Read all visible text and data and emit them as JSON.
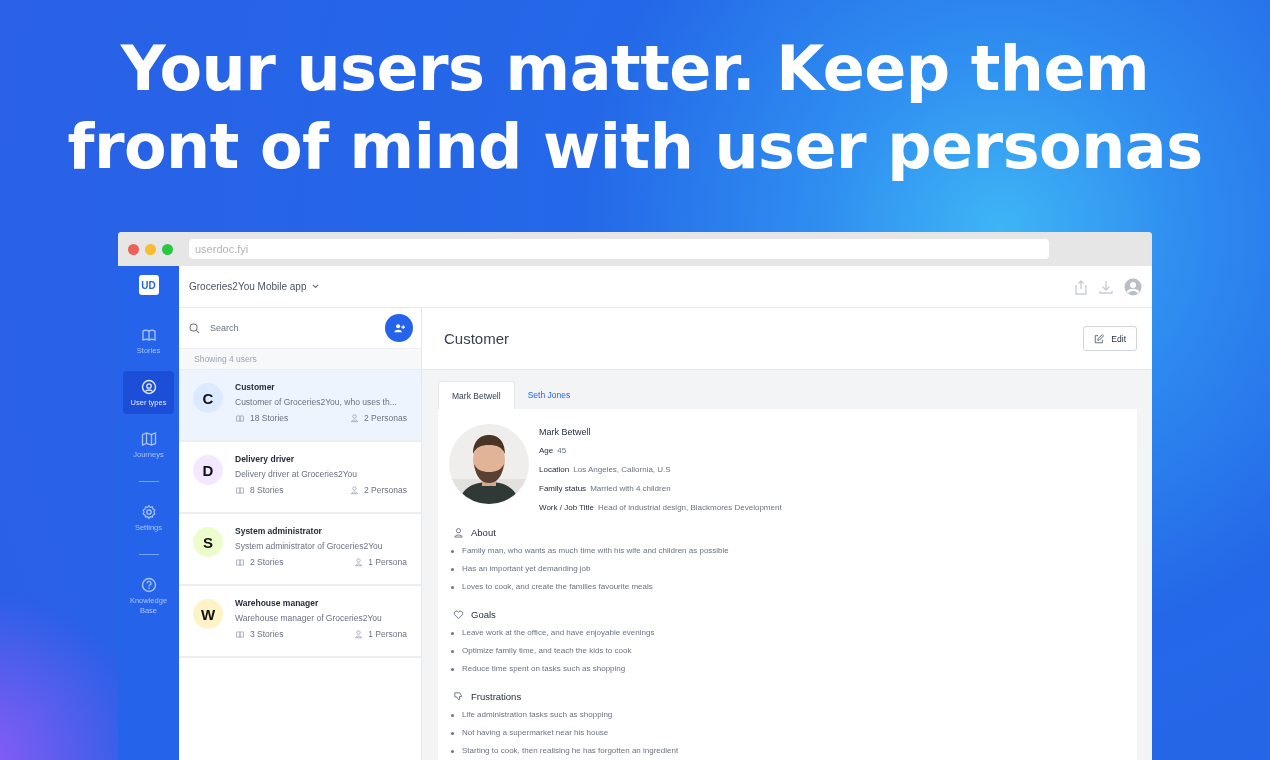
{
  "headline": {
    "lines": [
      "Your users matter. Keep them",
      "front of mind with user personas"
    ]
  },
  "browser": {
    "address": "userdoc.fyi"
  },
  "sidebar": {
    "logo": "UD",
    "groups": [
      [
        {
          "label": "Stories",
          "kind": "stories",
          "selected": false
        },
        {
          "label": "User types",
          "kind": "usertypes",
          "selected": true
        },
        {
          "label": "Journeys",
          "kind": "journeys",
          "selected": false
        }
      ],
      [
        {
          "label": "Settings",
          "kind": "settings",
          "selected": false
        }
      ],
      [
        {
          "label": "Knowledge Base",
          "kind": "help",
          "selected": false
        }
      ]
    ]
  },
  "project": {
    "name": "Groceries2You Mobile app"
  },
  "user_list": {
    "search_placeholder": "Search",
    "count": "Showing 4 users",
    "items": [
      {
        "initial": "C",
        "name": "Customer",
        "description": "Customer of Groceries2You, who uses th...",
        "stories": "18 Stories",
        "personas": "2 Personas",
        "color": "#dbeafe",
        "selected": true
      },
      {
        "initial": "D",
        "name": "Delivery driver",
        "description": "Delivery driver at Groceries2You",
        "stories": "8 Stories",
        "personas": "2 Personas",
        "color": "#f3e8ff",
        "selected": false
      },
      {
        "initial": "S",
        "name": "System administrator",
        "description": "System administrator of Groceries2You",
        "stories": "2 Stories",
        "personas": "1 Persona",
        "color": "#ecfccb",
        "selected": false
      },
      {
        "initial": "W",
        "name": "Warehouse manager",
        "description": "Warehouse manager of Groceries2You",
        "stories": "3 Stories",
        "personas": "1 Persona",
        "color": "#fef3c7",
        "selected": false
      }
    ]
  },
  "detail": {
    "title": "Customer",
    "edit": "Edit",
    "tabs": [
      {
        "label": "Mark Betwell",
        "selected": true
      },
      {
        "label": "Seth Jones",
        "selected": false
      }
    ],
    "persona": {
      "name": "Mark Betwell",
      "fields": [
        {
          "label": "Age",
          "value": "45"
        },
        {
          "label": "Location",
          "value": "Los Angeles, Caliornia, U.S"
        },
        {
          "label": "Family status",
          "value": "Married with 4 children"
        },
        {
          "label": "Work / Job Title",
          "value": "Head of industrial design, Blackmores Development"
        }
      ],
      "sections": [
        {
          "kind": "about",
          "title": "About",
          "items": [
            "Family man, who wants as much time with his wife and children as possible",
            "Has an important yet demanding job",
            "Loves to cook, and create the families favourite meals"
          ]
        },
        {
          "kind": "goals",
          "title": "Goals",
          "items": [
            "Leave work at the office, and have enjoyable evenings",
            "Optimize family time, and teach the kids to cook",
            "Reduce time spent on tasks such as shopping"
          ]
        },
        {
          "kind": "frustrations",
          "title": "Frustrations",
          "items": [
            "Life administration tasks such as shopping",
            "Not having a supermarket near his house",
            "Starting to cook, then realising he has forgotten an ingredient"
          ]
        }
      ]
    }
  }
}
